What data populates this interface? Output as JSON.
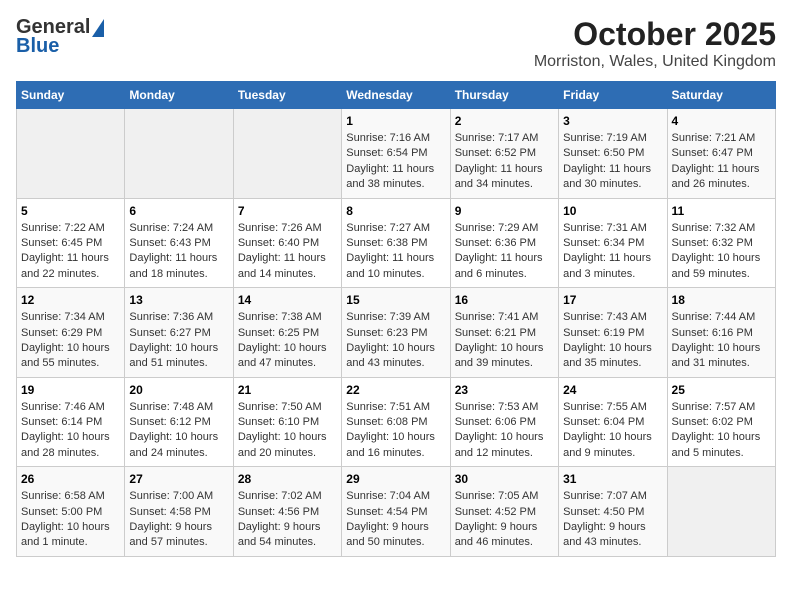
{
  "header": {
    "logo_general": "General",
    "logo_blue": "Blue",
    "title": "October 2025",
    "subtitle": "Morriston, Wales, United Kingdom"
  },
  "calendar": {
    "days_of_week": [
      "Sunday",
      "Monday",
      "Tuesday",
      "Wednesday",
      "Thursday",
      "Friday",
      "Saturday"
    ],
    "weeks": [
      [
        {
          "day": "",
          "info": ""
        },
        {
          "day": "",
          "info": ""
        },
        {
          "day": "",
          "info": ""
        },
        {
          "day": "1",
          "info": "Sunrise: 7:16 AM\nSunset: 6:54 PM\nDaylight: 11 hours and 38 minutes."
        },
        {
          "day": "2",
          "info": "Sunrise: 7:17 AM\nSunset: 6:52 PM\nDaylight: 11 hours and 34 minutes."
        },
        {
          "day": "3",
          "info": "Sunrise: 7:19 AM\nSunset: 6:50 PM\nDaylight: 11 hours and 30 minutes."
        },
        {
          "day": "4",
          "info": "Sunrise: 7:21 AM\nSunset: 6:47 PM\nDaylight: 11 hours and 26 minutes."
        }
      ],
      [
        {
          "day": "5",
          "info": "Sunrise: 7:22 AM\nSunset: 6:45 PM\nDaylight: 11 hours and 22 minutes."
        },
        {
          "day": "6",
          "info": "Sunrise: 7:24 AM\nSunset: 6:43 PM\nDaylight: 11 hours and 18 minutes."
        },
        {
          "day": "7",
          "info": "Sunrise: 7:26 AM\nSunset: 6:40 PM\nDaylight: 11 hours and 14 minutes."
        },
        {
          "day": "8",
          "info": "Sunrise: 7:27 AM\nSunset: 6:38 PM\nDaylight: 11 hours and 10 minutes."
        },
        {
          "day": "9",
          "info": "Sunrise: 7:29 AM\nSunset: 6:36 PM\nDaylight: 11 hours and 6 minutes."
        },
        {
          "day": "10",
          "info": "Sunrise: 7:31 AM\nSunset: 6:34 PM\nDaylight: 11 hours and 3 minutes."
        },
        {
          "day": "11",
          "info": "Sunrise: 7:32 AM\nSunset: 6:32 PM\nDaylight: 10 hours and 59 minutes."
        }
      ],
      [
        {
          "day": "12",
          "info": "Sunrise: 7:34 AM\nSunset: 6:29 PM\nDaylight: 10 hours and 55 minutes."
        },
        {
          "day": "13",
          "info": "Sunrise: 7:36 AM\nSunset: 6:27 PM\nDaylight: 10 hours and 51 minutes."
        },
        {
          "day": "14",
          "info": "Sunrise: 7:38 AM\nSunset: 6:25 PM\nDaylight: 10 hours and 47 minutes."
        },
        {
          "day": "15",
          "info": "Sunrise: 7:39 AM\nSunset: 6:23 PM\nDaylight: 10 hours and 43 minutes."
        },
        {
          "day": "16",
          "info": "Sunrise: 7:41 AM\nSunset: 6:21 PM\nDaylight: 10 hours and 39 minutes."
        },
        {
          "day": "17",
          "info": "Sunrise: 7:43 AM\nSunset: 6:19 PM\nDaylight: 10 hours and 35 minutes."
        },
        {
          "day": "18",
          "info": "Sunrise: 7:44 AM\nSunset: 6:16 PM\nDaylight: 10 hours and 31 minutes."
        }
      ],
      [
        {
          "day": "19",
          "info": "Sunrise: 7:46 AM\nSunset: 6:14 PM\nDaylight: 10 hours and 28 minutes."
        },
        {
          "day": "20",
          "info": "Sunrise: 7:48 AM\nSunset: 6:12 PM\nDaylight: 10 hours and 24 minutes."
        },
        {
          "day": "21",
          "info": "Sunrise: 7:50 AM\nSunset: 6:10 PM\nDaylight: 10 hours and 20 minutes."
        },
        {
          "day": "22",
          "info": "Sunrise: 7:51 AM\nSunset: 6:08 PM\nDaylight: 10 hours and 16 minutes."
        },
        {
          "day": "23",
          "info": "Sunrise: 7:53 AM\nSunset: 6:06 PM\nDaylight: 10 hours and 12 minutes."
        },
        {
          "day": "24",
          "info": "Sunrise: 7:55 AM\nSunset: 6:04 PM\nDaylight: 10 hours and 9 minutes."
        },
        {
          "day": "25",
          "info": "Sunrise: 7:57 AM\nSunset: 6:02 PM\nDaylight: 10 hours and 5 minutes."
        }
      ],
      [
        {
          "day": "26",
          "info": "Sunrise: 6:58 AM\nSunset: 5:00 PM\nDaylight: 10 hours and 1 minute."
        },
        {
          "day": "27",
          "info": "Sunrise: 7:00 AM\nSunset: 4:58 PM\nDaylight: 9 hours and 57 minutes."
        },
        {
          "day": "28",
          "info": "Sunrise: 7:02 AM\nSunset: 4:56 PM\nDaylight: 9 hours and 54 minutes."
        },
        {
          "day": "29",
          "info": "Sunrise: 7:04 AM\nSunset: 4:54 PM\nDaylight: 9 hours and 50 minutes."
        },
        {
          "day": "30",
          "info": "Sunrise: 7:05 AM\nSunset: 4:52 PM\nDaylight: 9 hours and 46 minutes."
        },
        {
          "day": "31",
          "info": "Sunrise: 7:07 AM\nSunset: 4:50 PM\nDaylight: 9 hours and 43 minutes."
        },
        {
          "day": "",
          "info": ""
        }
      ]
    ]
  }
}
